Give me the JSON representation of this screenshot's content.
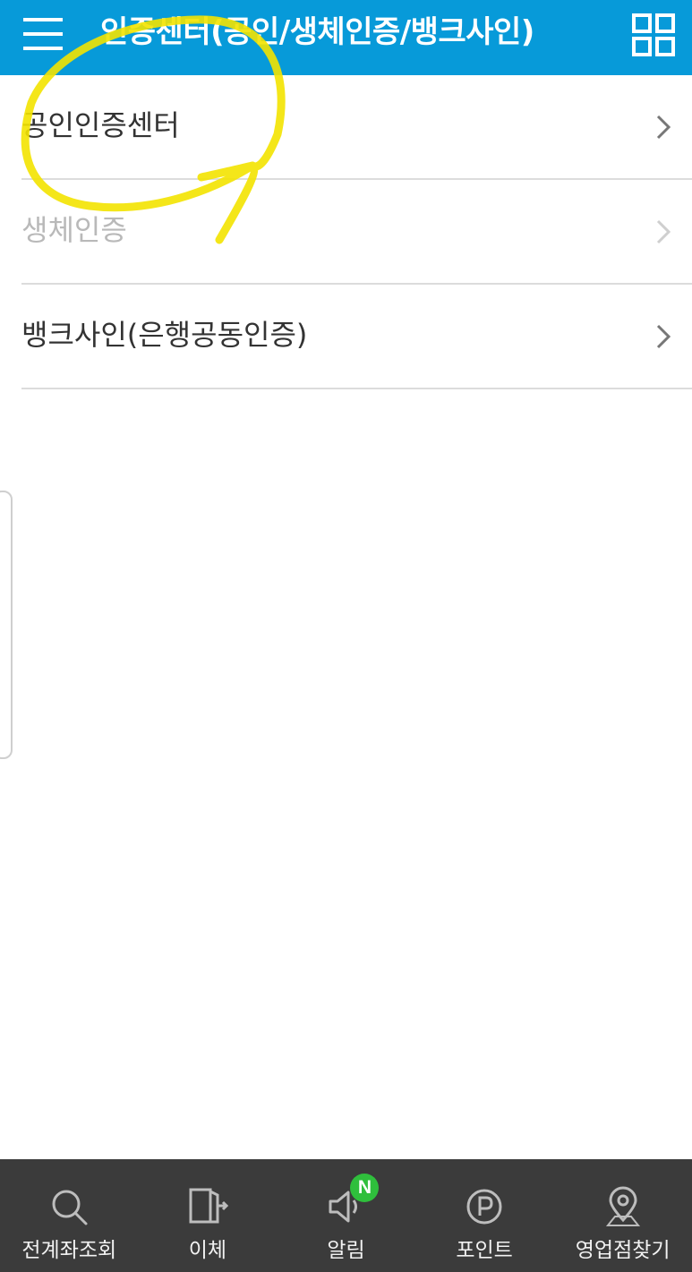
{
  "header": {
    "title": "인증센터(공인/생체인증/뱅크사인)",
    "menu_icon": "hamburger-menu-icon",
    "grid_icon": "grid-menu-icon",
    "background_color": "#079ad9"
  },
  "list": {
    "items": [
      {
        "label": "공인인증센터",
        "enabled": true
      },
      {
        "label": "생체인증",
        "enabled": false
      },
      {
        "label": "뱅크사인(은행공동인증)",
        "enabled": true
      }
    ]
  },
  "bottom_nav": {
    "items": [
      {
        "label": "전계좌조회",
        "icon": "search-icon"
      },
      {
        "label": "이체",
        "icon": "transfer-door-icon"
      },
      {
        "label": "알림",
        "icon": "speaker-icon",
        "badge": "N"
      },
      {
        "label": "포인트",
        "icon": "point-circle-icon"
      },
      {
        "label": "영업점찾기",
        "icon": "location-pin-icon"
      }
    ],
    "background_color": "#3b3b3b",
    "badge_color": "#2fbf3c"
  },
  "annotation": {
    "type": "yellow-freehand-circle-arrow",
    "color": "#f3e300"
  }
}
